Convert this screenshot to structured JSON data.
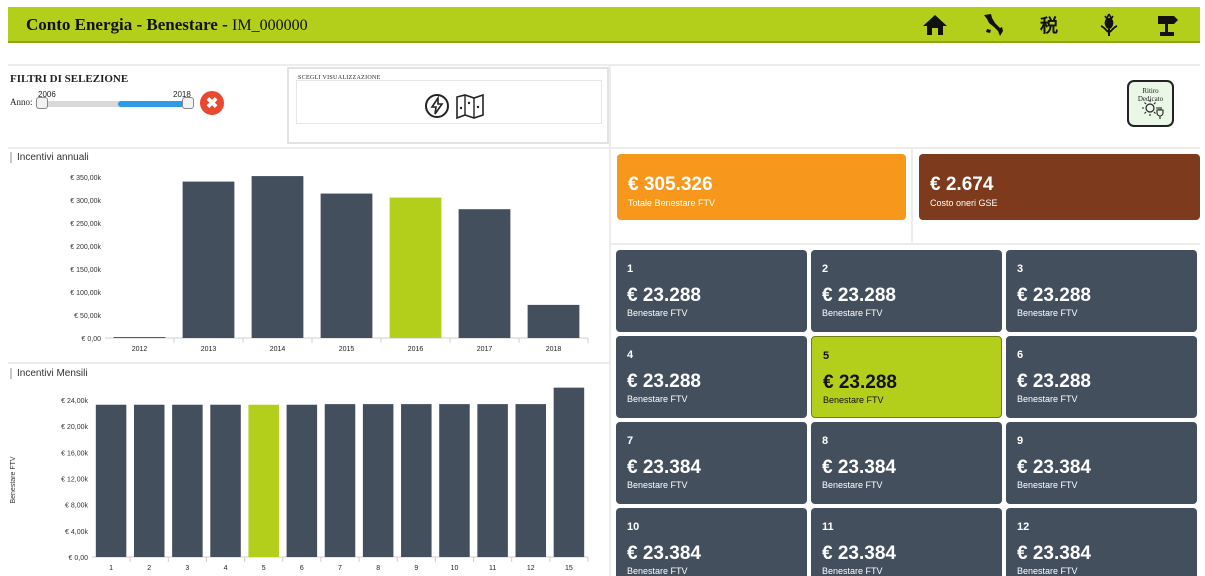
{
  "header": {
    "title": "Conto Energia - Benestare -",
    "plant_id": "IM_000000",
    "icons": [
      "home-icon",
      "italy-map-icon",
      "tax-icon",
      "thistle-icon",
      "signpost-icon"
    ]
  },
  "filters": {
    "title": "FILTRI DI SELEZIONE",
    "anno_label": "Anno:",
    "year_min": "2006",
    "year_max": "2018",
    "clear_symbol": "✖"
  },
  "view_selector": {
    "label": "SCEGLI VISUALIZZAZIONE",
    "icons": [
      "lightning-icon",
      "map-icon"
    ]
  },
  "ritiro_button": {
    "label": "Ritiro Dedicato",
    "icon": "sun-plug-icon"
  },
  "kpis": [
    {
      "value": "€ 305.326",
      "label": "Totale Benestare FTV",
      "color": "#f7981d"
    },
    {
      "value": "€ 2.674",
      "label": "Costo oneri GSE",
      "color": "#7e3a1c"
    }
  ],
  "tiles": [
    {
      "n": "1",
      "value": "€ 23.288",
      "label": "Benestare FTV"
    },
    {
      "n": "2",
      "value": "€ 23.288",
      "label": "Benestare FTV"
    },
    {
      "n": "3",
      "value": "€ 23.288",
      "label": "Benestare FTV"
    },
    {
      "n": "4",
      "value": "€ 23.288",
      "label": "Benestare FTV"
    },
    {
      "n": "5",
      "value": "€ 23.288",
      "label": "Benestare FTV"
    },
    {
      "n": "6",
      "value": "€ 23.288",
      "label": "Benestare FTV"
    },
    {
      "n": "7",
      "value": "€ 23.384",
      "label": "Benestare FTV"
    },
    {
      "n": "8",
      "value": "€ 23.384",
      "label": "Benestare FTV"
    },
    {
      "n": "9",
      "value": "€ 23.384",
      "label": "Benestare FTV"
    },
    {
      "n": "10",
      "value": "€ 23.384",
      "label": "Benestare FTV"
    },
    {
      "n": "11",
      "value": "€ 23.384",
      "label": "Benestare FTV"
    },
    {
      "n": "12",
      "value": "€ 23.384",
      "label": "Benestare FTV"
    }
  ],
  "selected_tile": "5",
  "colors": {
    "bar": "#444f5e",
    "highlight": "#b4cf1b",
    "accent": "#b4cf1b"
  },
  "chart_data": [
    {
      "type": "bar",
      "title": "Incentivi annuali",
      "categories": [
        "2012",
        "2013",
        "2014",
        "2015",
        "2016",
        "2017",
        "2018"
      ],
      "values": [
        2000,
        340000,
        352000,
        314000,
        305326,
        280000,
        72000
      ],
      "highlight": "2016",
      "yticks": [
        0,
        50000,
        100000,
        150000,
        200000,
        250000,
        300000,
        350000
      ],
      "ytick_labels": [
        "€ 0,00",
        "€ 50,00k",
        "€ 100,00k",
        "€ 150,00k",
        "€ 200,00k",
        "€ 250,00k",
        "€ 300,00k",
        "€ 350,00k"
      ],
      "ylim": [
        0,
        350000
      ],
      "ylabel": ""
    },
    {
      "type": "bar",
      "title": "Incentivi Mensili",
      "categories": [
        "1",
        "2",
        "3",
        "4",
        "5",
        "6",
        "7",
        "8",
        "9",
        "10",
        "11",
        "12",
        "15"
      ],
      "values": [
        23288,
        23288,
        23288,
        23288,
        23288,
        23288,
        23384,
        23384,
        23384,
        23384,
        23384,
        23384,
        25900
      ],
      "highlight": "5",
      "yticks": [
        0,
        4000,
        8000,
        12000,
        16000,
        20000,
        24000
      ],
      "ytick_labels": [
        "€ 0,00",
        "€ 4,00k",
        "€ 8,00k",
        "€ 12,00k",
        "€ 16,00k",
        "€ 20,00k",
        "€ 24,00k"
      ],
      "ylim": [
        0,
        26000
      ],
      "ylabel": "Benestare FTV"
    }
  ]
}
